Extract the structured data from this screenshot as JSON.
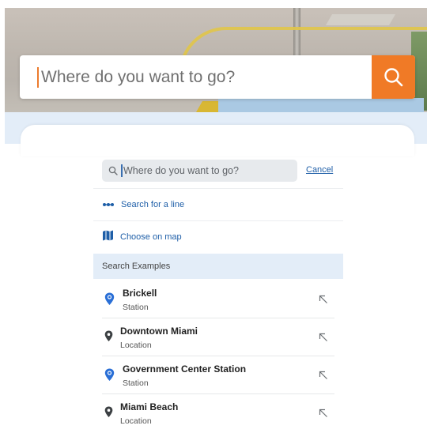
{
  "hero": {
    "search_placeholder": "Where do you want to go?",
    "search_button_icon": "search-icon",
    "accent_color": "#f07a26"
  },
  "search_panel": {
    "input_placeholder": "Where do you want to go?",
    "cancel_label": "Cancel",
    "actions": [
      {
        "icon": "dots-line-icon",
        "label": "Search for a line"
      },
      {
        "icon": "map-icon",
        "label": "Choose on map"
      }
    ],
    "section_title": "Search Examples",
    "results": [
      {
        "title": "Brickell",
        "subtitle": "Station",
        "icon": "station-pin-icon",
        "pin_color": "#2a6fd6"
      },
      {
        "title": "Downtown Miami",
        "subtitle": "Location",
        "icon": "location-pin-icon",
        "pin_color": "#3c4043"
      },
      {
        "title": "Government Center Station",
        "subtitle": "Station",
        "icon": "station-pin-icon",
        "pin_color": "#2a6fd6"
      },
      {
        "title": "Miami Beach",
        "subtitle": "Location",
        "icon": "location-pin-icon",
        "pin_color": "#3c4043"
      }
    ],
    "link_color": "#1f5fa8"
  }
}
